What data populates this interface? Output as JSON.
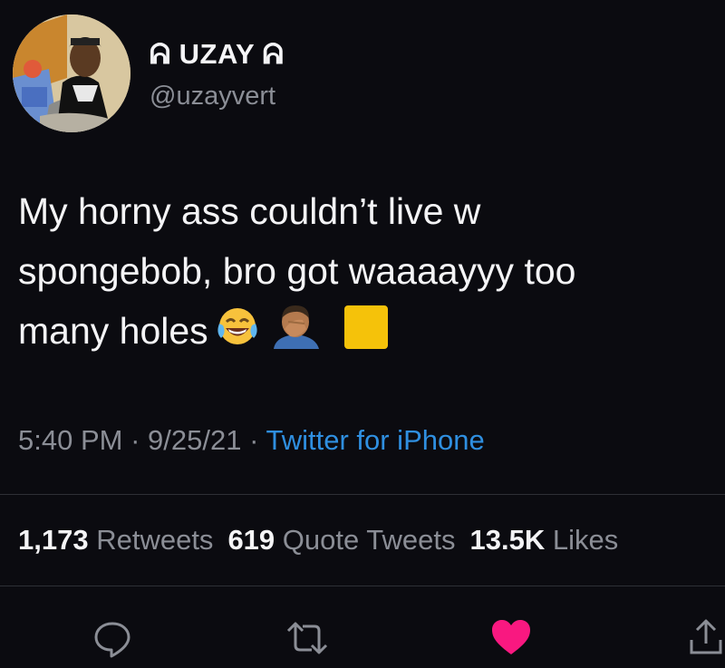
{
  "user": {
    "display_name": "ᕱ UZAY ᕱ",
    "handle": "@uzayvert"
  },
  "tweet": {
    "lines": [
      "My horny ass couldn’t live w",
      "spongebob, bro got waaaayyy too",
      "many holes"
    ],
    "emojis": [
      "face-with-tears-of-joy",
      "man-facepalming",
      "yellow-square"
    ]
  },
  "meta": {
    "time": "5:40 PM",
    "date": "9/25/21",
    "separator": "·",
    "source": "Twitter for iPhone"
  },
  "stats": {
    "retweets_count": "1,173",
    "retweets_label": "Retweets",
    "quotes_count": "619",
    "quotes_label": "Quote Tweets",
    "likes_count": "13.5K",
    "likes_label": "Likes"
  },
  "actions": [
    "reply-icon",
    "retweet-icon",
    "like-icon",
    "share-icon"
  ],
  "colors": {
    "background": "#0b0b10",
    "source_link": "#2f8fe0",
    "like": "#f91880",
    "muted": "#8b8e96"
  }
}
